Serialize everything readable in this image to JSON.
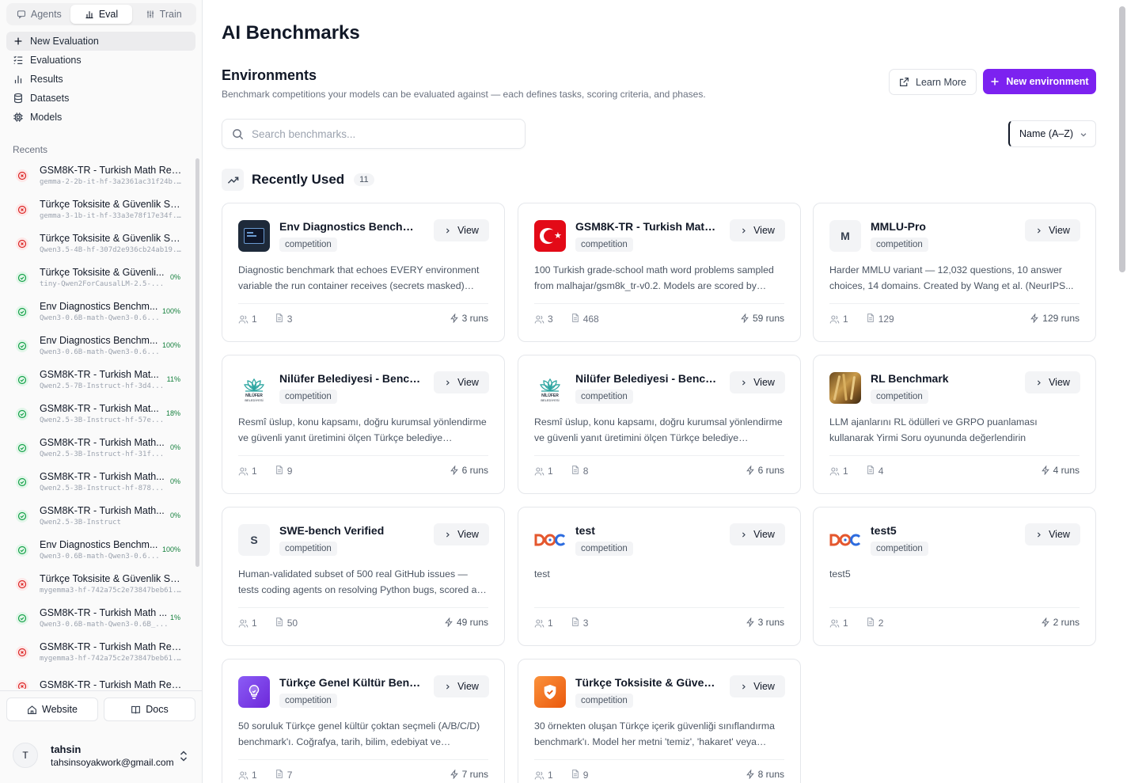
{
  "sidebar": {
    "mode_tabs": [
      {
        "label": "Agents",
        "icon": "chat-icon",
        "active": false
      },
      {
        "label": "Eval",
        "icon": "bar-chart-icon",
        "active": true
      },
      {
        "label": "Train",
        "icon": "sliders-icon",
        "active": false
      }
    ],
    "nav": [
      {
        "label": "New Evaluation",
        "icon": "plus-icon",
        "active": true
      },
      {
        "label": "Evaluations",
        "icon": "checklist-icon"
      },
      {
        "label": "Results",
        "icon": "bar-chart-icon"
      },
      {
        "label": "Datasets",
        "icon": "database-icon"
      },
      {
        "label": "Models",
        "icon": "cpu-icon"
      }
    ],
    "recents_label": "Recents",
    "recents": [
      {
        "title": "GSM8K-TR - Turkish Math Rea...",
        "subtitle": "gemma-2-2b-it-hf-3a2361ac31f24b...",
        "status": "fail",
        "pct": ""
      },
      {
        "title": "Türkçe Toksisite & Güvenlik Sın...",
        "subtitle": "gemma-3-1b-it-hf-33a3e78f17e34f...",
        "status": "fail",
        "pct": ""
      },
      {
        "title": "Türkçe Toksisite & Güvenlik Sın...",
        "subtitle": "Qwen3.5-4B-hf-307d2e936cb24ab19...",
        "status": "fail",
        "pct": ""
      },
      {
        "title": "Türkçe Toksisite & Güvenli...",
        "subtitle": "tiny-Qwen2ForCausalLM-2.5-...",
        "status": "ok",
        "pct": "0%"
      },
      {
        "title": "Env Diagnostics Benchm...",
        "subtitle": "Qwen3-0.6B-math-Qwen3-0.6...",
        "status": "ok",
        "pct": "100%"
      },
      {
        "title": "Env Diagnostics Benchm...",
        "subtitle": "Qwen3-0.6B-math-Qwen3-0.6...",
        "status": "ok",
        "pct": "100%"
      },
      {
        "title": "GSM8K-TR - Turkish Mat...",
        "subtitle": "Qwen2.5-7B-Instruct-hf-3d4...",
        "status": "ok",
        "pct": "11%"
      },
      {
        "title": "GSM8K-TR - Turkish Mat...",
        "subtitle": "Qwen2.5-3B-Instruct-hf-57e...",
        "status": "ok",
        "pct": "18%"
      },
      {
        "title": "GSM8K-TR - Turkish Math...",
        "subtitle": "Qwen2.5-3B-Instruct-hf-31f...",
        "status": "ok",
        "pct": "0%"
      },
      {
        "title": "GSM8K-TR - Turkish Math...",
        "subtitle": "Qwen2.5-3B-Instruct-hf-878...",
        "status": "ok",
        "pct": "0%"
      },
      {
        "title": "GSM8K-TR - Turkish Math...",
        "subtitle": "Qwen2.5-3B-Instruct",
        "status": "ok",
        "pct": "0%"
      },
      {
        "title": "Env Diagnostics Benchm...",
        "subtitle": "Qwen3-0.6B-math-Qwen3-0.6...",
        "status": "ok",
        "pct": "100%"
      },
      {
        "title": "Türkçe Toksisite & Güvenlik Sın...",
        "subtitle": "mygemma3-hf-742a75c2e73847beb61...",
        "status": "fail",
        "pct": ""
      },
      {
        "title": "GSM8K-TR - Turkish Math ...",
        "subtitle": "Qwen3-0.6B-math-Qwen3-0.6B_...",
        "status": "ok",
        "pct": "1%"
      },
      {
        "title": "GSM8K-TR - Turkish Math Rea...",
        "subtitle": "mygemma3-hf-742a75c2e73847beb61...",
        "status": "fail",
        "pct": ""
      },
      {
        "title": "GSM8K-TR - Turkish Math Rea...",
        "subtitle": "",
        "status": "fail",
        "pct": ""
      }
    ],
    "website_label": "Website",
    "docs_label": "Docs",
    "user": {
      "initial": "T",
      "name": "tahsin",
      "email": "tahsinsoyakwork@gmail.com"
    }
  },
  "main": {
    "page_title": "AI Benchmarks",
    "section_title": "Environments",
    "section_desc": "Benchmark competitions your models can be evaluated against — each defines tasks, scoring criteria, and phases.",
    "learn_more_label": "Learn More",
    "new_env_label": "New environment",
    "search_placeholder": "Search benchmarks...",
    "sort_value": "Name (A–Z)",
    "recent_title": "Recently Used",
    "recent_count": "11",
    "view_label": "View",
    "cards": [
      {
        "title": "Env Diagnostics Benchmark",
        "tag": "competition",
        "icon": "terminal-icon",
        "desc": "Diagnostic benchmark that echoes EVERY environment variable the run container receives (secrets masked) into...",
        "users": "1",
        "docs": "3",
        "runs": "3 runs"
      },
      {
        "title": "GSM8K-TR - Turkish Math ...",
        "tag": "competition",
        "icon": "turkey-flag-icon",
        "desc": "100 Turkish grade-school math word problems sampled from malhajar/gsm8k_tr-v0.2. Models are scored by exact...",
        "users": "3",
        "docs": "468",
        "runs": "59 runs"
      },
      {
        "title": "MMLU-Pro",
        "tag": "competition",
        "icon": "letter-avatar-icon",
        "letter": "M",
        "desc": "Harder MMLU variant — 12,032 questions, 10 answer choices, 14 domains. Created by Wang et al. (NeurIPS...",
        "users": "1",
        "docs": "129",
        "runs": "129 runs"
      },
      {
        "title": "Nilüfer Belediyesi - Bench...",
        "tag": "competition",
        "icon": "nilufer-logo-icon",
        "desc": "Resmî üslup, konu kapsamı, doğru kurumsal yönlendirme ve güvenli yanıt üretimini ölçen Türkçe belediye vatandaş...",
        "users": "1",
        "docs": "9",
        "runs": "6 runs"
      },
      {
        "title": "Nilüfer Belediyesi - Bench...",
        "tag": "competition",
        "icon": "nilufer-logo-icon",
        "desc": "Resmî üslup, konu kapsamı, doğru kurumsal yönlendirme ve güvenli yanıt üretimini ölçen Türkçe belediye vatandaş...",
        "users": "1",
        "docs": "8",
        "runs": "6 runs"
      },
      {
        "title": "RL Benchmark",
        "tag": "competition",
        "icon": "wheat-photo-icon",
        "desc": "LLM ajanlarını RL ödülleri ve GRPO puanlaması kullanarak Yirmi Soru oyununda değerlendirin",
        "users": "1",
        "docs": "4",
        "runs": "4 runs"
      },
      {
        "title": "SWE-bench Verified",
        "tag": "competition",
        "icon": "letter-avatar-icon",
        "letter": "S",
        "desc": "Human-validated subset of 500 real GitHub issues — tests coding agents on resolving Python bugs, scored as % of...",
        "users": "1",
        "docs": "50",
        "runs": "49 runs"
      },
      {
        "title": "test",
        "tag": "competition",
        "icon": "dog-logo-icon",
        "desc": "test",
        "users": "1",
        "docs": "3",
        "runs": "3 runs"
      },
      {
        "title": "test5",
        "tag": "competition",
        "icon": "dog-logo-icon",
        "desc": "test5",
        "users": "1",
        "docs": "2",
        "runs": "2 runs"
      },
      {
        "title": "Türkçe Genel Kültür Bench...",
        "tag": "competition",
        "icon": "lightbulb-icon",
        "desc": "50 soruluk Türkçe genel kültür çoktan seçmeli (A/B/C/D) benchmark'ı. Coğrafya, tarih, bilim, edebiyat ve matematik...",
        "users": "1",
        "docs": "7",
        "runs": "7 runs"
      },
      {
        "title": "Türkçe Toksisite & Güvenlik...",
        "tag": "competition",
        "icon": "shield-check-icon",
        "desc": "30 örnekten oluşan Türkçe içerik güvenliği sınıflandırma benchmark'ı. Model her metni 'temiz', 'hakaret' veya 'tehd...",
        "users": "1",
        "docs": "9",
        "runs": "8 runs"
      }
    ]
  },
  "colors": {
    "primary": "#7c22f0",
    "success": "#16a34a",
    "danger": "#dc2626"
  }
}
